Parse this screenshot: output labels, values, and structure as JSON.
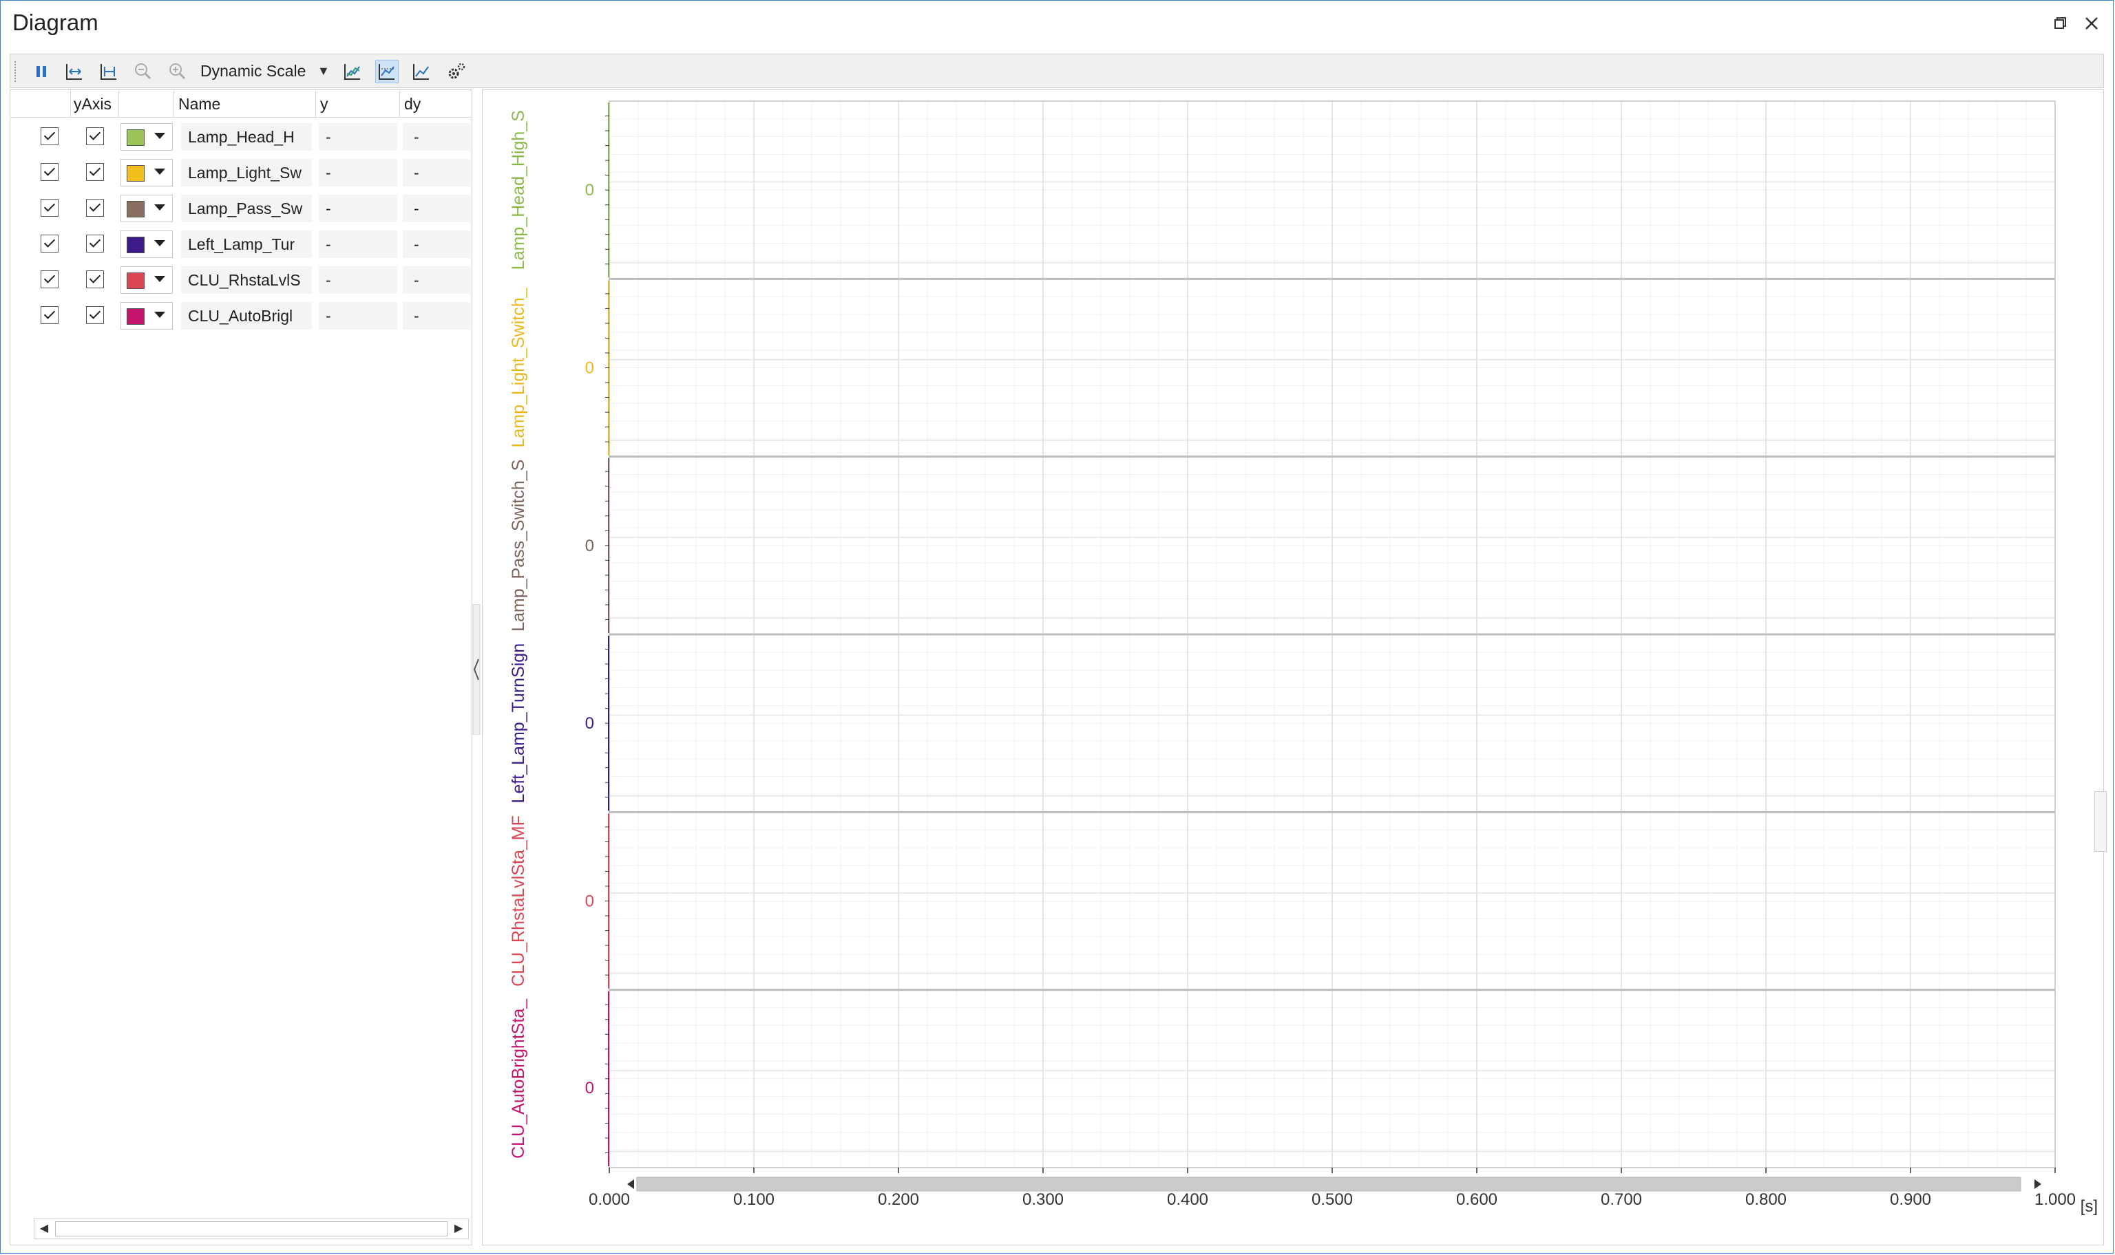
{
  "window": {
    "title": "Diagram"
  },
  "toolbar": {
    "scale_mode": "Dynamic Scale",
    "buttons": [
      "pause-icon",
      "fit-x-icon",
      "fit-range-icon",
      "zoom-out-icon",
      "zoom-in-icon",
      "chart-settings-icon",
      "chart-icon",
      "chart-alt-icon",
      "gear-icon"
    ]
  },
  "table": {
    "headers": {
      "enable": "",
      "yaxis": "yAxis",
      "color": "",
      "name": "Name",
      "y": "y",
      "dy": "dy"
    },
    "rows": [
      {
        "name": "Lamp_Head_H",
        "y": "-",
        "dy": "-",
        "color": "#9bc35a"
      },
      {
        "name": "Lamp_Light_Sw",
        "y": "-",
        "dy": "-",
        "color": "#f2be1c"
      },
      {
        "name": "Lamp_Pass_Sw",
        "y": "-",
        "dy": "-",
        "color": "#8a6e62"
      },
      {
        "name": "Left_Lamp_Tur",
        "y": "-",
        "dy": "-",
        "color": "#3d1a8c"
      },
      {
        "name": "CLU_RhstaLvlS",
        "y": "-",
        "dy": "-",
        "color": "#dc4654"
      },
      {
        "name": "CLU_AutoBrigl",
        "y": "-",
        "dy": "-",
        "color": "#c4146e"
      }
    ]
  },
  "chart_data": {
    "type": "line",
    "x_unit": "[s]",
    "xlim": [
      0,
      1.0
    ],
    "x_ticks": [
      "0.000",
      "0.100",
      "0.200",
      "0.300",
      "0.400",
      "0.500",
      "0.600",
      "0.700",
      "0.800",
      "0.900",
      "1.000"
    ],
    "series": [
      {
        "name": "Lamp_Head_High_S",
        "color": "#8cb84a",
        "y_tick": "0",
        "values": []
      },
      {
        "name": "Lamp_Light_Switch_",
        "color": "#eab71c",
        "y_tick": "0",
        "values": []
      },
      {
        "name": "Lamp_Pass_Switch_S",
        "color": "#7a645a",
        "y_tick": "0",
        "values": []
      },
      {
        "name": "Left_Lamp_TurnSign",
        "color": "#3d1a8c",
        "y_tick": "0",
        "values": []
      },
      {
        "name": "CLU_RhstaLvlSta_MF",
        "color": "#dc4654",
        "y_tick": "0",
        "values": []
      },
      {
        "name": "CLU_AutoBrightSta_",
        "color": "#c4146e",
        "y_tick": "0",
        "values": []
      }
    ]
  }
}
